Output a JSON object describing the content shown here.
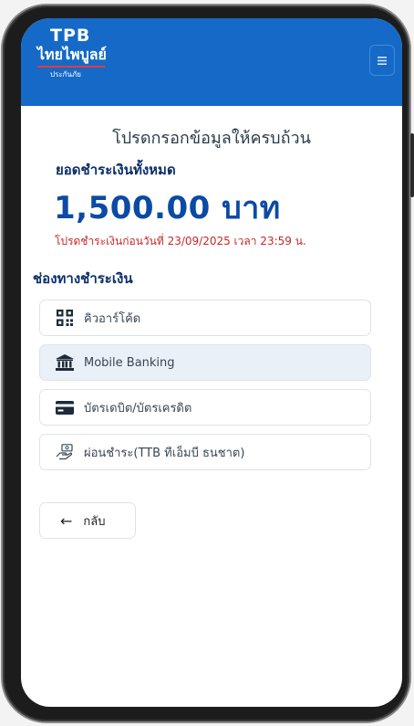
{
  "header": {
    "brand_short": "TPB",
    "brand_thai": "ไทยไพบูลย์",
    "brand_sub": "ประกันภัย",
    "menu_icon": "hamburger-menu-icon"
  },
  "payment": {
    "prompt": "โปรดกรอกข้อมูลให้ครบถ้วน",
    "total_label": "ยอดชำระเงินทั้งหมด",
    "amount": "1,500.00 บาท",
    "due_text": "โปรดชำระเงินก่อนวันที่ 23/09/2025 เวลา 23:59 น.",
    "channels_label": "ช่องทางชำระเงิน"
  },
  "options": [
    {
      "label": "คิวอาร์โค้ด",
      "icon": "qr-code-icon"
    },
    {
      "label": "Mobile Banking",
      "icon": "bank-icon",
      "selected": true
    },
    {
      "label": "บัตรเดบิต/บัตรเครดิต",
      "icon": "credit-card-icon"
    },
    {
      "label": "ผ่อนชำระ(TTB ทีเอ็มบี ธนชาต)",
      "icon": "installment-hand-icon"
    }
  ],
  "back": {
    "label": "กลับ",
    "icon": "arrow-left-icon"
  },
  "colors": {
    "header_blue": "#1569c7",
    "amount_blue": "#0b4aa5",
    "due_red": "#c62828",
    "selected_bg": "#eaf0f7"
  }
}
